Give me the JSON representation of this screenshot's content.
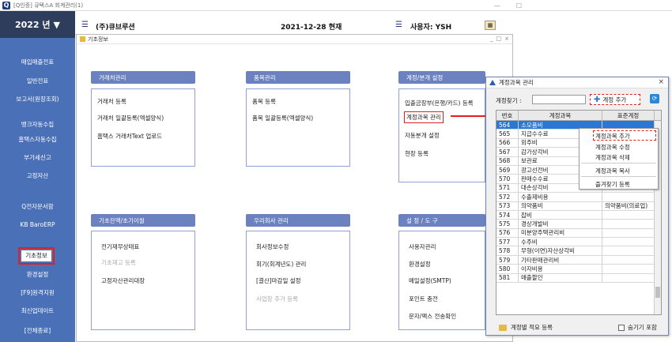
{
  "window": {
    "title": "[Q인증] 큐택스A   회계관리(1)",
    "min": "—",
    "max": "☐"
  },
  "sidebar": {
    "year": "2022 년",
    "year_arrow": "▼",
    "items": [
      "매입매출전표",
      "일반전표",
      "보고서(원장조회)",
      "뱅크자동수집",
      "홈택스자동수집",
      "부가세신고",
      "고정자산",
      "Q전자문서함",
      "KB BaroERP",
      "기초정보",
      "환경설정",
      "[F9]원격지원",
      "최신업데이트",
      "[전체종료]"
    ]
  },
  "header": {
    "company": "(주)큐브루션",
    "date": "2021-12-28 현재",
    "user": "사용자: YSH"
  },
  "inner": {
    "title": "기초정보",
    "btn_min": "_",
    "btn_max": "□",
    "btn_close": "×"
  },
  "groups": [
    {
      "title": "거래처관리",
      "items": [
        "거래처 등록",
        "거래처 일괄등록(엑셀양식)",
        "홈택스 거래처Text 업로드"
      ]
    },
    {
      "title": "품목관리",
      "items": [
        "품목 등록",
        "품목 일괄등록(엑셀양식)"
      ]
    },
    {
      "title": "계정/분개 설정",
      "items": [
        "입출금장부(은행/카드) 등록",
        "계정과목 관리",
        "자동분개 설정",
        "현장 등록"
      ]
    },
    {
      "title": "기초잔액/초기이월",
      "items": [
        "전기재무상태표",
        "기초재고 등록",
        "고정자산관리대장"
      ]
    },
    {
      "title": "우리회사 관리",
      "items": [
        "회사정보수정",
        "회기(회계년도) 관리",
        "[결산]마감일 설정",
        "사업장 추가 등록"
      ]
    },
    {
      "title": "설 정 / 도 구",
      "items": [
        "사용자관리",
        "환경설정",
        "메일설정(SMTP)",
        "포인트 충전",
        "문자/팩스 전송확인"
      ]
    }
  ],
  "dialog": {
    "title": "계정과목 관리",
    "close": "×",
    "search_label": "계정찾기 :",
    "search_value": "",
    "add_button": "계정 추가",
    "columns": [
      "번호",
      "계정과목",
      "표준계정"
    ],
    "rows": [
      [
        "564",
        "소모품비",
        ""
      ],
      [
        "565",
        "지급수수료",
        ""
      ],
      [
        "566",
        "외주비",
        ""
      ],
      [
        "567",
        "감가상각비",
        ""
      ],
      [
        "568",
        "보관료",
        ""
      ],
      [
        "569",
        "광고선전비",
        ""
      ],
      [
        "570",
        "판매수수료",
        ""
      ],
      [
        "571",
        "대손상각비",
        ""
      ],
      [
        "572",
        "수출제비용",
        ""
      ],
      [
        "573",
        "의약품비",
        "의약품비(의료업)"
      ],
      [
        "574",
        "잡비",
        ""
      ],
      [
        "575",
        "경상개발비",
        ""
      ],
      [
        "576",
        "미분양주택관리비",
        ""
      ],
      [
        "577",
        "수주비",
        ""
      ],
      [
        "578",
        "무형(이연)자산상각비",
        ""
      ],
      [
        "579",
        "기타판매관리비",
        ""
      ],
      [
        "580",
        "이자비용",
        ""
      ],
      [
        "581",
        "매출할인",
        ""
      ]
    ],
    "context_menu": [
      "계정과목 추가",
      "계정과목 수정",
      "계정과목 삭제",
      "계정과목 복사",
      "즐겨찾기 등록"
    ],
    "footer_left": "계정별 적요 등록",
    "footer_right": "숨기기 포함"
  }
}
